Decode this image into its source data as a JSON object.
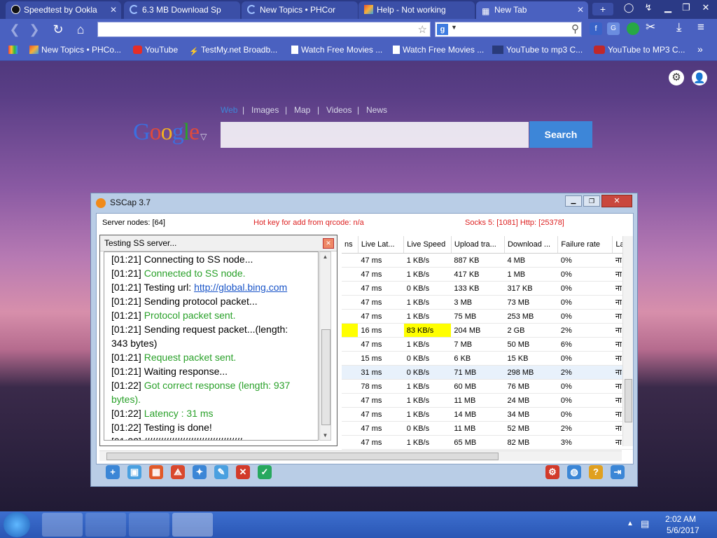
{
  "tabs": [
    {
      "label": "Speedtest by Ookla",
      "icon": "speedtest-icon"
    },
    {
      "label": "6.3 MB Download Sp",
      "icon": "loading-icon"
    },
    {
      "label": "New Topics • PHCor",
      "icon": "loading-icon"
    },
    {
      "label": "Help - Not working",
      "icon": "box-icon"
    },
    {
      "label": "New Tab",
      "icon": "grid-icon"
    }
  ],
  "bookmarks": [
    {
      "label": "New Topics • PHCo..."
    },
    {
      "label": "YouTube"
    },
    {
      "label": "TestMy.net Broadb..."
    },
    {
      "label": "Watch Free Movies ..."
    },
    {
      "label": "Watch Free Movies ..."
    },
    {
      "label": "YouTube to mp3 C..."
    },
    {
      "label": "YouTube to MP3 C..."
    }
  ],
  "google": {
    "nav": [
      "Web",
      "Images",
      "Map",
      "Videos",
      "News"
    ],
    "logo": "Google",
    "search_label": "Search"
  },
  "sscap": {
    "title": "SSCap 3.7",
    "server_nodes": "Server nodes: [64]",
    "hotkey": "Hot key for add from qrcode: n/a",
    "socks": "Socks 5: [1081] Http: [25378]",
    "columns": [
      "ns",
      "Live Lat...",
      "Live Speed",
      "Upload tra...",
      "Download ...",
      "Failure rate",
      "Las"
    ],
    "rows": [
      [
        "47 ms",
        "1 KB/s",
        "887 KB",
        "4 MB",
        "0%",
        "ना"
      ],
      [
        "47 ms",
        "1 KB/s",
        "417 KB",
        "1 MB",
        "0%",
        "ना"
      ],
      [
        "47 ms",
        "0 KB/s",
        "133 KB",
        "317 KB",
        "0%",
        "ना"
      ],
      [
        "47 ms",
        "1 KB/s",
        "3 MB",
        "73 MB",
        "0%",
        "ना"
      ],
      [
        "47 ms",
        "1 KB/s",
        "75 MB",
        "253 MB",
        "0%",
        "ना"
      ],
      [
        "16 ms",
        "83 KB/s",
        "204 MB",
        "2 GB",
        "2%",
        "ना"
      ],
      [
        "47 ms",
        "1 KB/s",
        "7 MB",
        "50 MB",
        "6%",
        "ना"
      ],
      [
        "15 ms",
        "0 KB/s",
        "6 KB",
        "15 KB",
        "0%",
        "ना"
      ],
      [
        "31 ms",
        "0 KB/s",
        "71 MB",
        "298 MB",
        "2%",
        "ना"
      ],
      [
        "78 ms",
        "1 KB/s",
        "60 MB",
        "76 MB",
        "0%",
        "ना"
      ],
      [
        "47 ms",
        "1 KB/s",
        "11 MB",
        "24 MB",
        "0%",
        "ना"
      ],
      [
        "47 ms",
        "1 KB/s",
        "14 MB",
        "34 MB",
        "0%",
        "ना"
      ],
      [
        "47 ms",
        "0 KB/s",
        "11 MB",
        "52 MB",
        "2%",
        "ना"
      ],
      [
        "47 ms",
        "1 KB/s",
        "65 MB",
        "82 MB",
        "3%",
        "ना"
      ]
    ]
  },
  "popup": {
    "title": "Testing SS server...",
    "log": [
      {
        "t": "[01:21]",
        "msg": "Connecting to SS node...",
        "green": false
      },
      {
        "t": "[01:21]",
        "msg": "Connected to SS node.",
        "green": true
      },
      {
        "t": "[01:21]",
        "msg": "Testing url: ",
        "link": "http://global.bing.com",
        "green": false
      },
      {
        "t": "[01:21]",
        "msg": "Sending protocol packet...",
        "green": false
      },
      {
        "t": "[01:21]",
        "msg": "Protocol packet sent.",
        "green": true
      },
      {
        "t": "[01:21]",
        "msg": "Sending request packet...(length:",
        "green": false
      },
      {
        "t": "",
        "msg": "343 bytes)",
        "green": false
      },
      {
        "t": "[01:21]",
        "msg": "Request packet sent.",
        "green": true
      },
      {
        "t": "[01:21]",
        "msg": "Waiting response...",
        "green": false
      },
      {
        "t": "[01:22]",
        "msg": "Got correct response (length: 937",
        "green": true
      },
      {
        "t": "",
        "msg": "bytes).",
        "green": true
      },
      {
        "t": "[01:22]",
        "msg": "Latency : 31 ms",
        "green": true
      },
      {
        "t": "[01:22]",
        "msg": "Testing is done!",
        "green": false
      },
      {
        "t": "[01:22]",
        "msg": "////////////////////////////////////",
        "green": false
      }
    ]
  },
  "clock": {
    "time": "2:02 AM",
    "date": "5/6/2017"
  },
  "colors": {
    "chrome": "#4a61c0",
    "highlight": "#ffff00",
    "green": "#2aa12a",
    "google_btn": "#3d86d8"
  }
}
